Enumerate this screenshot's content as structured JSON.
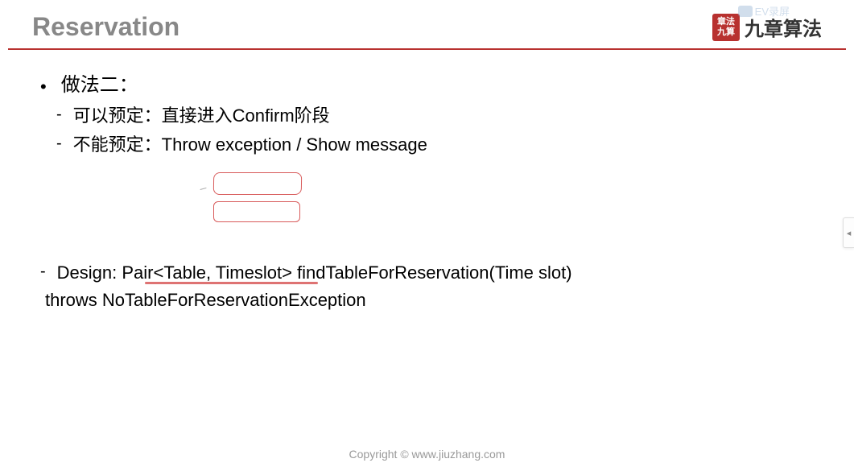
{
  "header": {
    "title": "Reservation",
    "logo_seal": "章法\n九算",
    "logo_text": "九章算法"
  },
  "watermark": {
    "text": "EV录屏"
  },
  "content": {
    "main_bullet": "做法二：",
    "sub_bullet_1": "可以预定：直接进入Confirm阶段",
    "sub_bullet_2": "不能预定：Throw exception / Show message",
    "design_prefix": "-",
    "design_line_1": "Design: Pair<Table, Timeslot> findTableForReservation(Time slot)",
    "design_line_2": "throws NoTableForReservationException"
  },
  "footer": {
    "copyright": "Copyright © www.jiuzhang.com"
  },
  "side_tab": {
    "glyph": "◂"
  }
}
